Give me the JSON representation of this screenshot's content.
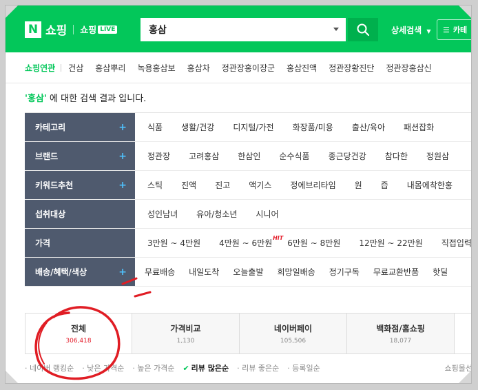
{
  "header": {
    "logo_mark": "N",
    "logo_text": "쇼핑",
    "live_text": "쇼핑",
    "live_badge": "LIVE",
    "search_value": "홍삼",
    "detail_search": "상세검색",
    "category_button": "카테",
    "brand_color": "#03c75a"
  },
  "related": {
    "label": "쇼핑연관",
    "items": [
      "건삼",
      "홍삼뿌리",
      "녹용홍삼보",
      "홍삼차",
      "정관장홍이장군",
      "홍삼진액",
      "정관장황진단",
      "정관장홍삼신"
    ]
  },
  "result": {
    "keyword": "'홍삼'",
    "message": " 에 대한 검색 결과 입니다."
  },
  "filters": [
    {
      "label": "카테고리",
      "plus": "+",
      "items": [
        "식품",
        "생활/건강",
        "디지털/가전",
        "화장품/미용",
        "출산/육아",
        "패션잡화"
      ]
    },
    {
      "label": "브랜드",
      "plus": "+",
      "items": [
        "정관장",
        "고려홍삼",
        "한삼인",
        "순수식품",
        "종근당건강",
        "참다한",
        "정원삼"
      ]
    },
    {
      "label": "키워드추천",
      "plus": "+",
      "items": [
        "스틱",
        "진액",
        "진고",
        "액기스",
        "정에브리타임",
        "원",
        "즙",
        "내몸에착한홍"
      ]
    },
    {
      "label": "섭취대상",
      "plus": "",
      "items": [
        "성인남녀",
        "유아/청소년",
        "시니어"
      ]
    },
    {
      "label": "가격",
      "plus": "",
      "items": [
        "3만원 ~ 4만원",
        "4만원 ~ 6만원",
        "6만원 ~ 8만원",
        "12만원 ~ 22만원",
        "직접입력"
      ]
    },
    {
      "label": "배송/혜택/색상",
      "plus": "+",
      "items": [
        "무료배송",
        "내일도착",
        "오늘출발",
        "희망일배송",
        "정기구독",
        "무료교환반품",
        "핫딜"
      ]
    }
  ],
  "hit_badge": "HIT",
  "tabs": [
    {
      "name": "전체",
      "count": "306,418"
    },
    {
      "name": "가격비교",
      "count": "1,130"
    },
    {
      "name": "네이버페이",
      "count": "105,506"
    },
    {
      "name": "백화점/홈쇼핑",
      "count": "18,077"
    }
  ],
  "sort": {
    "items": [
      "네이버 랭킹순",
      "낮은 가격순",
      "높은 가격순",
      "리뷰 많은순",
      "리뷰 좋은순",
      "등록일순"
    ],
    "active_index": 3,
    "right": "쇼핑몰선"
  }
}
